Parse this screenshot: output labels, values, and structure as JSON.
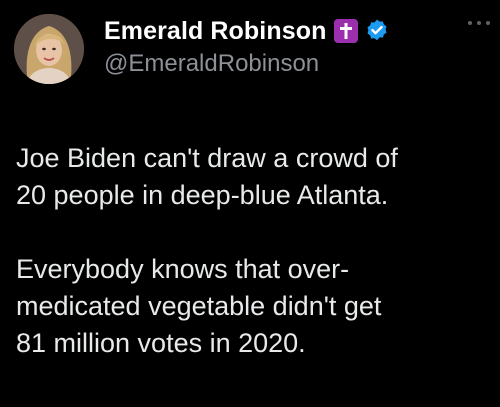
{
  "author": {
    "display_name": "Emerald Robinson",
    "handle": "@EmeraldRobinson",
    "badges": [
      "cross-icon",
      "verified-icon"
    ],
    "verified_color": "#1d9bf0",
    "cross_badge_color": "#9b2fae"
  },
  "menu": {
    "more_icon": "more-horizontal-icon"
  },
  "tweet": {
    "paragraphs": [
      {
        "lines": [
          "Joe Biden can't draw a crowd of",
          "20 people in deep-blue Atlanta."
        ]
      },
      {
        "lines": [
          "Everybody knows that over-",
          "medicated vegetable didn't get",
          "81 million votes in 2020."
        ]
      }
    ]
  },
  "colors": {
    "background": "#000000",
    "text_primary": "#e7e9ea",
    "text_secondary": "#8b9196"
  }
}
